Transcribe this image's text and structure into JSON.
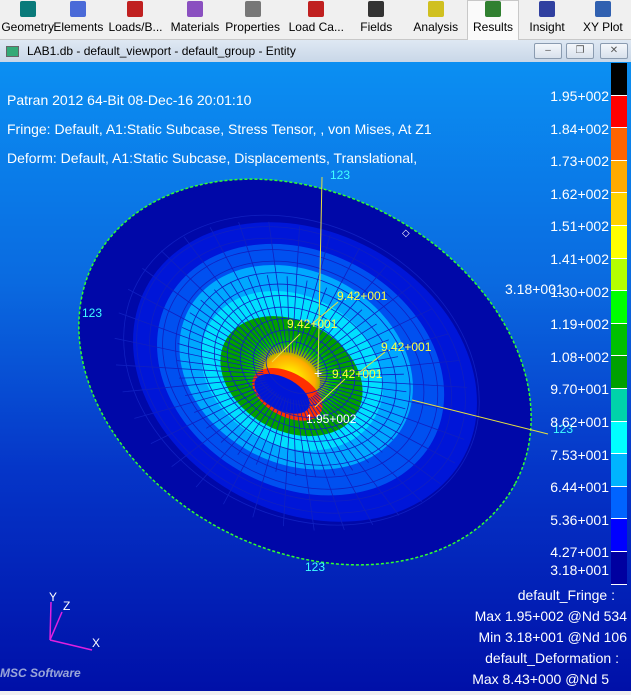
{
  "toolbar": {
    "items": [
      {
        "label": "Geometry",
        "icon": "geometry-icon",
        "color": "#0a7a7a"
      },
      {
        "label": "Elements",
        "icon": "elements-icon",
        "color": "#4a6ad8"
      },
      {
        "label": "Loads/B...",
        "icon": "loads-icon",
        "color": "#c02020"
      },
      {
        "label": "Materials",
        "icon": "materials-icon",
        "color": "#8a50c0"
      },
      {
        "label": "Properties",
        "icon": "properties-icon",
        "color": "#777777"
      },
      {
        "label": "Load Ca...",
        "icon": "load-cases-icon",
        "color": "#c02020"
      },
      {
        "label": "Fields",
        "icon": "fields-icon",
        "color": "#333333"
      },
      {
        "label": "Analysis",
        "icon": "analysis-icon",
        "color": "#d0c020"
      },
      {
        "label": "Results",
        "icon": "results-icon",
        "color": "#308030"
      },
      {
        "label": "Insight",
        "icon": "insight-icon",
        "color": "#3040a0"
      },
      {
        "label": "XY Plot",
        "icon": "xy-plot-icon",
        "color": "#3060b0"
      }
    ],
    "active": "Results"
  },
  "window": {
    "title": "LAB1.db - default_viewport - default_group - Entity",
    "minimize": "–",
    "restore": "❐",
    "close": "✕"
  },
  "viewport": {
    "header": [
      "Patran 2012 64-Bit 08-Dec-16 20:01:10",
      "Fringe: Default, A1:Static Subcase, Stress Tensor, , von Mises, At Z1",
      "Deform: Default, A1:Static Subcase, Displacements, Translational,"
    ],
    "colorbar": {
      "labels": [
        "1.95+002",
        "1.84+002",
        "1.73+002",
        "1.62+002",
        "1.51+002",
        "1.41+002",
        "1.30+002",
        "1.19+002",
        "1.08+002",
        "9.70+001",
        "8.62+001",
        "7.53+001",
        "6.44+001",
        "5.36+001",
        "4.27+001",
        "3.18+001"
      ],
      "colors": [
        "#000000",
        "#ff0000",
        "#ff6400",
        "#ffaa00",
        "#ffd200",
        "#ffff00",
        "#b4ff00",
        "#00ff00",
        "#00c000",
        "#00a000",
        "#00d2aa",
        "#00ffff",
        "#00b4ff",
        "#0064ff",
        "#0000ff",
        "#0000a0"
      ]
    },
    "annotations": {
      "node_label": "123",
      "value_label": "9.42+001",
      "max_label": "1.95+002",
      "min_label": "3.18+001"
    },
    "info": {
      "fringe_title": "default_Fringe :",
      "fringe_max": "Max 1.95+002 @Nd 534",
      "fringe_min": "Min 3.18+001 @Nd 106",
      "deform_title": "default_Deformation :",
      "deform_max": "Max 8.43+000 @Nd 5"
    },
    "axes": {
      "x": "X",
      "y": "Y",
      "z": "Z"
    },
    "logo": "MSC Software"
  }
}
